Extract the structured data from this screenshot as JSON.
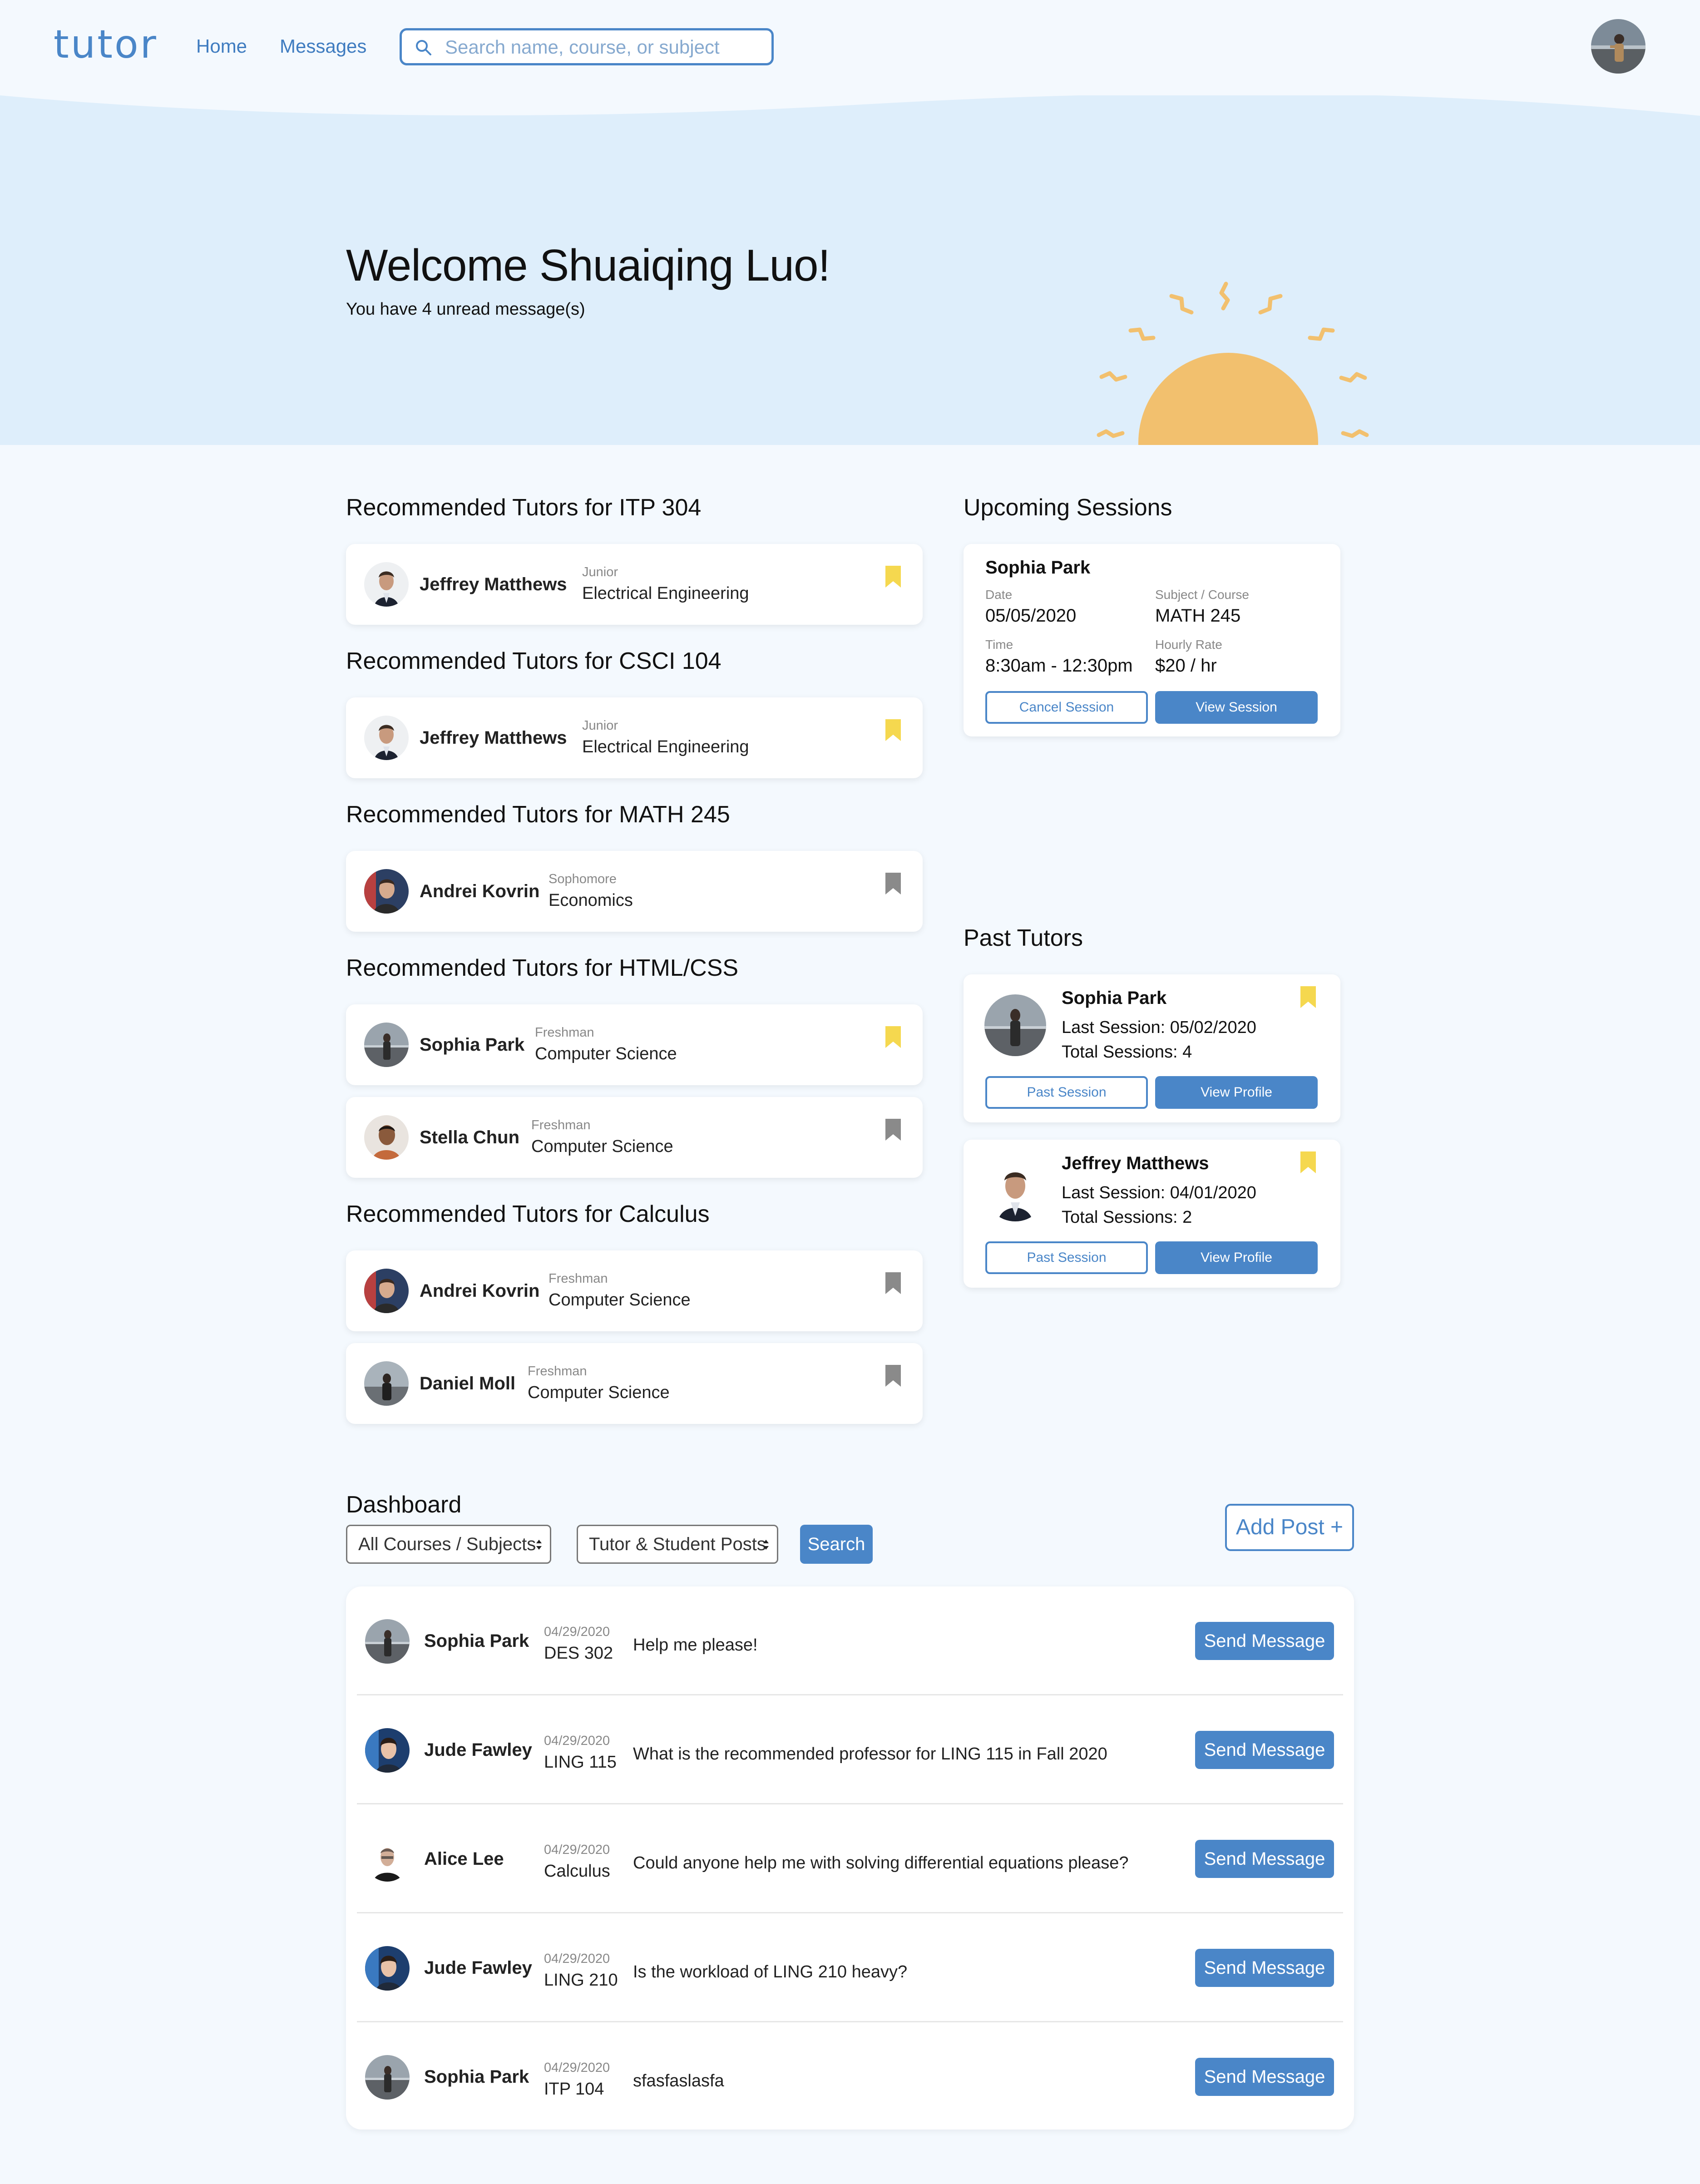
{
  "nav": {
    "logo": "tutor",
    "home_label": "Home",
    "messages_label": "Messages",
    "search_placeholder": "Search name, course, or subject"
  },
  "hero": {
    "welcome": "Welcome Shuaiqing Luo!",
    "unread": "You have 4 unread message(s)"
  },
  "recommended": [
    {
      "title": "Recommended Tutors for ITP 304",
      "tutors": [
        {
          "name": "Jeffrey Matthews",
          "year": "Junior",
          "major": "Electrical Engineering",
          "bookmarked": true
        }
      ]
    },
    {
      "title": "Recommended Tutors for CSCI 104",
      "tutors": [
        {
          "name": "Jeffrey Matthews",
          "year": "Junior",
          "major": "Electrical Engineering",
          "bookmarked": true
        }
      ]
    },
    {
      "title": "Recommended Tutors for MATH 245",
      "tutors": [
        {
          "name": "Andrei Kovrin",
          "year": "Sophomore",
          "major": "Economics",
          "bookmarked": false
        }
      ]
    },
    {
      "title": "Recommended Tutors for HTML/CSS",
      "tutors": [
        {
          "name": "Sophia Park",
          "year": "Freshman",
          "major": "Computer Science",
          "bookmarked": true
        },
        {
          "name": "Stella Chun",
          "year": "Freshman",
          "major": "Computer Science",
          "bookmarked": false
        }
      ]
    },
    {
      "title": "Recommended Tutors for Calculus",
      "tutors": [
        {
          "name": "Andrei Kovrin",
          "year": "Freshman",
          "major": "Computer Science",
          "bookmarked": false
        },
        {
          "name": "Daniel Moll",
          "year": "Freshman",
          "major": "Computer Science",
          "bookmarked": false
        }
      ]
    }
  ],
  "upcoming": {
    "title": "Upcoming Sessions",
    "session": {
      "name": "Sophia Park",
      "date_label": "Date",
      "date": "05/05/2020",
      "subject_label": "Subject / Course",
      "subject": "MATH 245",
      "time_label": "Time",
      "time": "8:30am - 12:30pm",
      "rate_label": "Hourly Rate",
      "rate": "$20 / hr",
      "cancel_label": "Cancel Session",
      "view_label": "View Session"
    }
  },
  "past": {
    "title": "Past Tutors",
    "tutors": [
      {
        "name": "Sophia Park",
        "last": "Last Session: 05/02/2020",
        "total": "Total Sessions: 4",
        "bookmarked": true,
        "past_label": "Past Session",
        "profile_label": "View Profile"
      },
      {
        "name": "Jeffrey Matthews",
        "last": "Last Session: 04/01/2020",
        "total": "Total Sessions: 2",
        "bookmarked": true,
        "past_label": "Past Session",
        "profile_label": "View Profile"
      }
    ]
  },
  "dashboard": {
    "title": "Dashboard",
    "course_filter": "All Courses / Subjects",
    "post_filter": "Tutor & Student Posts",
    "search_label": "Search",
    "add_post_label": "Add Post +",
    "send_label": "Send Message",
    "posts": [
      {
        "name": "Sophia Park",
        "date": "04/29/2020",
        "course": "DES 302",
        "text": "Help me please!"
      },
      {
        "name": "Jude Fawley",
        "date": "04/29/2020",
        "course": "LING 115",
        "text": "What is the recommended professor for LING 115 in Fall 2020"
      },
      {
        "name": "Alice Lee",
        "date": "04/29/2020",
        "course": "Calculus",
        "text": "Could anyone help me with solving differential equations please?"
      },
      {
        "name": "Jude Fawley",
        "date": "04/29/2020",
        "course": "LING 210",
        "text": "Is the workload of LING 210 heavy?"
      },
      {
        "name": "Sophia Park",
        "date": "04/29/2020",
        "course": "ITP 104",
        "text": "sfasfaslasfa"
      }
    ]
  },
  "colors": {
    "accent": "#4a86c8",
    "hero_bg": "#deeefb",
    "page_bg": "#f4f9fe",
    "bookmark_on": "#f5d84f",
    "bookmark_off": "#8a8a8a",
    "sun": "#f2c06e"
  },
  "icons": {
    "search": "search-icon",
    "bookmark": "bookmark-icon",
    "sort": "sort-arrows-icon",
    "sun": "sun-illustration"
  }
}
